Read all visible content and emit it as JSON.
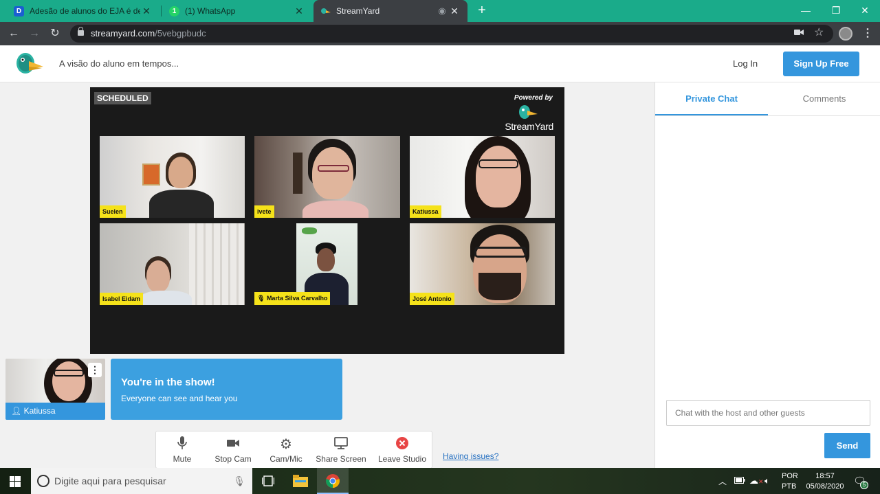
{
  "browser": {
    "tabs": [
      {
        "label": "Adesão de alunos do EJA é desafio",
        "favicon": "D"
      },
      {
        "label": "(1) WhatsApp",
        "favicon": "1"
      },
      {
        "label": "StreamYard",
        "favicon": ""
      }
    ],
    "url_domain": "streamyard.com",
    "url_path": "/5vebgpbudc"
  },
  "header": {
    "broadcast_title": "A visão do aluno em tempos...",
    "login_label": "Log In",
    "signup_label": "Sign Up Free"
  },
  "stage": {
    "status_badge": "SCHEDULED",
    "powered_by": "Powered by",
    "brand": "StreamYard",
    "participants": [
      {
        "name": "Suelen"
      },
      {
        "name": "ivete"
      },
      {
        "name": "Katiussa"
      },
      {
        "name": "Isabel Eidam"
      },
      {
        "name": "Marta Silva Carvalho",
        "muted": true
      },
      {
        "name": "José Antonio"
      }
    ]
  },
  "self_view": {
    "name": "Katiussa"
  },
  "banner": {
    "heading": "You're in the show!",
    "subtext": "Everyone can see and hear you"
  },
  "controls": [
    {
      "label": "Mute",
      "icon": "microphone-icon"
    },
    {
      "label": "Stop Cam",
      "icon": "camera-icon"
    },
    {
      "label": "Cam/Mic",
      "icon": "gear-icon"
    },
    {
      "label": "Share Screen",
      "icon": "monitor-icon"
    },
    {
      "label": "Leave Studio",
      "icon": "close-circle-icon"
    }
  ],
  "having_issues": "Having issues?",
  "chat": {
    "tab_private": "Private Chat",
    "tab_comments": "Comments",
    "input_placeholder": "Chat with the host and other guests",
    "send_label": "Send"
  },
  "taskbar": {
    "search_placeholder": "Digite aqui para pesquisar",
    "lang_top": "POR",
    "lang_bottom": "PTB",
    "time": "18:57",
    "date": "05/08/2020",
    "notifications": "5"
  },
  "colors": {
    "accent": "#3496dd",
    "tab_strip": "#1aab8a",
    "name_tag": "#f5e21a",
    "leave": "#e84545"
  }
}
